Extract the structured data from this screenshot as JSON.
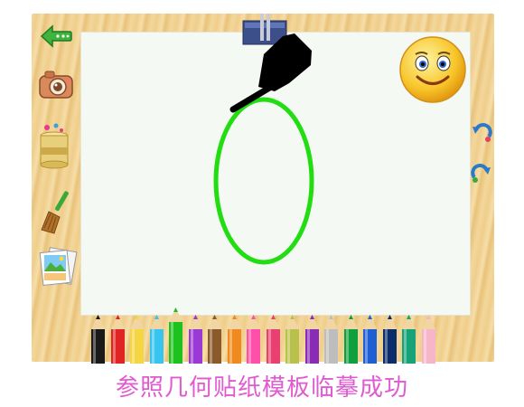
{
  "caption": "参照几何贴纸模板临摹成功",
  "toolbar": {
    "back_icon": "back-arrow-icon",
    "camera_icon": "camera-icon",
    "fill_icon": "paint-bucket-icon",
    "clear_icon": "broom-icon",
    "gallery_icon": "gallery-icon"
  },
  "canvas": {
    "template_shape": "ellipse",
    "stroke_color": "#22dd11",
    "pen_icon": "marker-pen-icon"
  },
  "right_panel": {
    "feedback_icon": "smiley-face-icon",
    "undo_icon": "undo-icon",
    "redo_icon": "redo-icon"
  },
  "palette": {
    "colors": [
      "#1a1a1a",
      "#e02424",
      "#f5d542",
      "#36c4f0",
      "#1ec21e",
      "#9b39d6",
      "#8b5a2b",
      "#f08a1e",
      "#ff4fa8",
      "#e84070",
      "#b8c24a",
      "#8a2bb8",
      "#bdbdbd",
      "#0e9f3e",
      "#1f5fd6",
      "#0b2d6b",
      "#17a37a",
      "#f6b5c8"
    ],
    "selected_index": 4
  },
  "colors": {
    "frame": "#f3d79a",
    "caption": "#e05ad0"
  }
}
